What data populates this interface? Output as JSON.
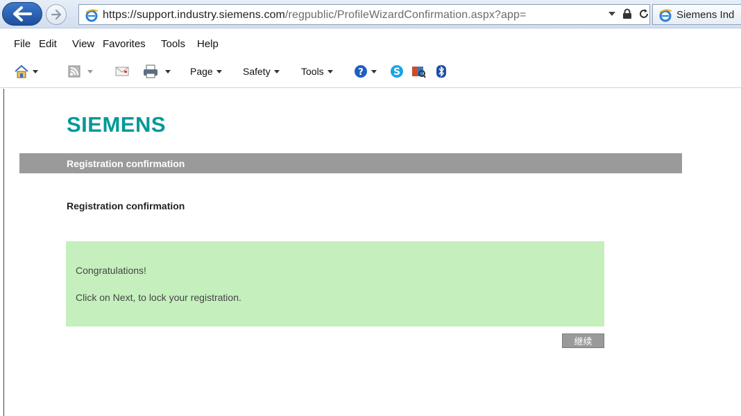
{
  "browser": {
    "url_host": "https://support.industry.siemens.com",
    "url_path": "/regpublic/ProfileWizardConfirmation.aspx?app=",
    "tab_title": "Siemens Ind",
    "colors": {
      "back_button": "#2a62b8"
    }
  },
  "menu": {
    "items": [
      "File",
      "Edit",
      "View",
      "Favorites",
      "Tools",
      "Help"
    ]
  },
  "commandbar": {
    "page_label": "Page",
    "safety_label": "Safety",
    "tools_label": "Tools"
  },
  "page": {
    "logo_text": "SIEMENS",
    "banner_title": "Registration confirmation",
    "section_title": "Registration confirmation",
    "message_line1": "Congratulations!",
    "message_line2": "Click on Next, to lock your registration.",
    "next_button_label": "继续",
    "colors": {
      "brand": "#009999",
      "banner": "#9a9a9a",
      "success_box": "#c6efbe"
    }
  },
  "icons": [
    "back-arrow-icon",
    "forward-arrow-icon",
    "ie-icon",
    "dropdown-icon",
    "lock-icon",
    "refresh-icon",
    "home-icon",
    "rss-feed-icon",
    "mail-icon",
    "print-icon",
    "help-icon",
    "skype-icon",
    "research-icon",
    "bluetooth-icon"
  ]
}
